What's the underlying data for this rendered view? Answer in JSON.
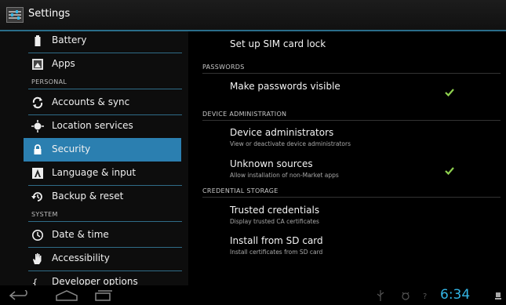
{
  "app": {
    "title": "Settings",
    "icon": "settings-icon"
  },
  "sidebar": {
    "items": [
      {
        "label": "Battery",
        "icon": "battery-icon"
      },
      {
        "label": "Apps",
        "icon": "apps-icon"
      },
      {
        "header": "PERSONAL"
      },
      {
        "label": "Accounts & sync",
        "icon": "sync-icon"
      },
      {
        "label": "Location services",
        "icon": "location-icon"
      },
      {
        "label": "Security",
        "icon": "lock-icon",
        "selected": true
      },
      {
        "label": "Language & input",
        "icon": "language-icon"
      },
      {
        "label": "Backup & reset",
        "icon": "backup-icon"
      },
      {
        "header": "SYSTEM"
      },
      {
        "label": "Date & time",
        "icon": "clock-icon"
      },
      {
        "label": "Accessibility",
        "icon": "hand-icon"
      },
      {
        "label": "Developer options",
        "icon": "braces-icon"
      }
    ]
  },
  "main": {
    "sim_lock": {
      "title": "Set up SIM card lock"
    },
    "sections": {
      "passwords": "PASSWORDS",
      "device_admin": "DEVICE ADMINISTRATION",
      "credential_storage": "CREDENTIAL STORAGE"
    },
    "prefs": {
      "make_passwords_visible": {
        "title": "Make passwords visible",
        "checked": true
      },
      "device_administrators": {
        "title": "Device administrators",
        "summary": "View or deactivate device administrators"
      },
      "unknown_sources": {
        "title": "Unknown sources",
        "summary": "Allow installation of non-Market apps",
        "checked": true
      },
      "trusted_credentials": {
        "title": "Trusted credentials",
        "summary": "Display trusted CA certificates"
      },
      "install_from_sd": {
        "title": "Install from SD card",
        "summary": "Install certificates from SD card"
      }
    }
  },
  "system_bar": {
    "clock": "6:34",
    "accent": "#33b5e5",
    "buttons": [
      "back-icon",
      "home-icon",
      "recent-apps-icon"
    ]
  }
}
